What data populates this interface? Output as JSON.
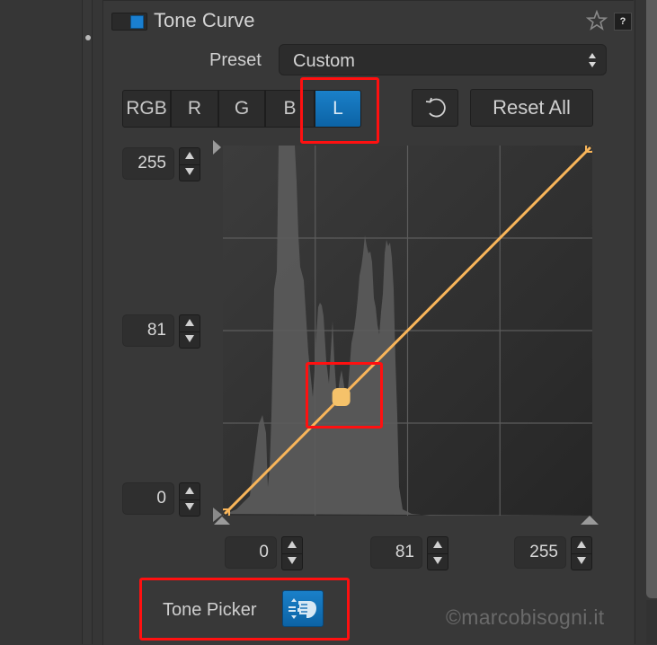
{
  "panel": {
    "title": "Tone Curve",
    "enabled": true,
    "help_label": "?"
  },
  "preset": {
    "label": "Preset",
    "value": "Custom"
  },
  "channels": {
    "items": [
      {
        "label": "RGB",
        "active": false
      },
      {
        "label": "R",
        "active": false
      },
      {
        "label": "G",
        "active": false
      },
      {
        "label": "B",
        "active": false
      },
      {
        "label": "L",
        "active": true
      }
    ]
  },
  "actions": {
    "undo_icon": "undo-icon",
    "reset_all_label": "Reset All"
  },
  "output_fields": {
    "top": "255",
    "mid": "81",
    "bottom": "0"
  },
  "input_fields": {
    "left": "0",
    "mid": "81",
    "right": "255"
  },
  "curve": {
    "color": "#f8b55a",
    "points": [
      {
        "input": 0,
        "output": 0
      },
      {
        "input": 81,
        "output": 81
      },
      {
        "input": 255,
        "output": 255
      }
    ],
    "selected_point": {
      "input": 81,
      "output": 81
    },
    "grid_divisions": 4
  },
  "tone_picker": {
    "label": "Tone Picker",
    "active": true
  },
  "watermark": "©marcobisogni.it",
  "colors": {
    "accent": "#1a7fd0",
    "highlight": "#ff1010",
    "curve": "#f8b55a"
  }
}
